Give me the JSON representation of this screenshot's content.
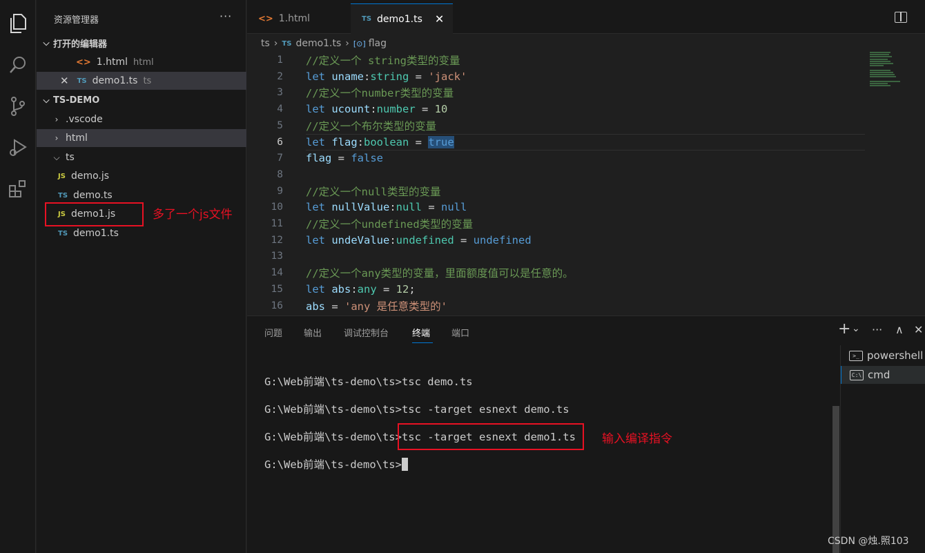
{
  "activity_bar": {
    "icons": [
      "explorer-icon",
      "search-icon",
      "source-control-icon",
      "run-debug-icon",
      "extensions-icon"
    ]
  },
  "sidebar": {
    "title": "资源管理器",
    "more": "···",
    "open_editors_label": "打开的编辑器",
    "open_editors": [
      {
        "name": "1.html",
        "hint": "html",
        "ext": "<>"
      },
      {
        "name": "demo1.ts",
        "hint": "ts",
        "ext": "TS"
      }
    ],
    "project_label": "TS-DEMO",
    "tree": [
      {
        "name": ".vscode",
        "kind": "folder"
      },
      {
        "name": "html",
        "kind": "folder"
      },
      {
        "name": "ts",
        "kind": "folder-open"
      },
      {
        "name": "demo.js",
        "ext": "JS"
      },
      {
        "name": "demo.ts",
        "ext": "TS"
      },
      {
        "name": "demo1.js",
        "ext": "JS"
      },
      {
        "name": "demo1.ts",
        "ext": "TS"
      }
    ],
    "annotation": "多了一个js文件"
  },
  "tabs": [
    {
      "label": "1.html",
      "ext": "<>"
    },
    {
      "label": "demo1.ts",
      "ext": "TS",
      "close": "✕"
    }
  ],
  "breadcrumb": {
    "folder": "ts",
    "file_ext": "TS",
    "file": "demo1.ts",
    "symbol_icon": "[⊙]",
    "symbol": "flag"
  },
  "code_lines": [
    {
      "n": "1",
      "tokens": [
        [
          "c-com",
          "//定义一个 string类型的变量"
        ]
      ]
    },
    {
      "n": "2",
      "tokens": [
        [
          "c-kw",
          "let "
        ],
        [
          "c-var",
          "uname"
        ],
        [
          "c-op",
          ":"
        ],
        [
          "c-type",
          "string"
        ],
        [
          "c-op",
          " = "
        ],
        [
          "c-str",
          "'jack'"
        ]
      ]
    },
    {
      "n": "3",
      "tokens": [
        [
          "c-com",
          "//定义一个number类型的变量"
        ]
      ]
    },
    {
      "n": "4",
      "tokens": [
        [
          "c-kw",
          "let "
        ],
        [
          "c-var",
          "ucount"
        ],
        [
          "c-op",
          ":"
        ],
        [
          "c-type",
          "number"
        ],
        [
          "c-op",
          " = "
        ],
        [
          "c-num",
          "10"
        ]
      ]
    },
    {
      "n": "5",
      "tokens": [
        [
          "c-com",
          "//定义一个布尔类型的变量"
        ]
      ]
    },
    {
      "n": "6",
      "tokens": [
        [
          "c-kw",
          "let "
        ],
        [
          "c-var",
          "flag"
        ],
        [
          "c-op",
          ":"
        ],
        [
          "c-type",
          "boolean"
        ],
        [
          "c-op",
          " = "
        ],
        [
          "c-kw c-sel",
          "true"
        ]
      ]
    },
    {
      "n": "7",
      "tokens": [
        [
          "c-var",
          "flag"
        ],
        [
          "c-op",
          " = "
        ],
        [
          "c-kw",
          "false"
        ]
      ]
    },
    {
      "n": "8",
      "tokens": []
    },
    {
      "n": "9",
      "tokens": [
        [
          "c-com",
          "//定义一个null类型的变量"
        ]
      ]
    },
    {
      "n": "10",
      "tokens": [
        [
          "c-kw",
          "let "
        ],
        [
          "c-var",
          "nullValue"
        ],
        [
          "c-op",
          ":"
        ],
        [
          "c-type",
          "null"
        ],
        [
          "c-op",
          " = "
        ],
        [
          "c-kw",
          "null"
        ]
      ]
    },
    {
      "n": "11",
      "tokens": [
        [
          "c-com",
          "//定义一个undefined类型的变量"
        ]
      ]
    },
    {
      "n": "12",
      "tokens": [
        [
          "c-kw",
          "let "
        ],
        [
          "c-var",
          "undeValue"
        ],
        [
          "c-op",
          ":"
        ],
        [
          "c-type",
          "undefined"
        ],
        [
          "c-op",
          " = "
        ],
        [
          "c-kw",
          "undefined"
        ]
      ]
    },
    {
      "n": "13",
      "tokens": []
    },
    {
      "n": "14",
      "tokens": [
        [
          "c-com",
          "//定义一个any类型的变量，里面额度值可以是任意的。"
        ]
      ]
    },
    {
      "n": "15",
      "tokens": [
        [
          "c-kw",
          "let "
        ],
        [
          "c-var",
          "abs"
        ],
        [
          "c-op",
          ":"
        ],
        [
          "c-type",
          "any"
        ],
        [
          "c-op",
          " = "
        ],
        [
          "c-num",
          "12"
        ],
        [
          "c-op",
          ";"
        ]
      ]
    },
    {
      "n": "16",
      "tokens": [
        [
          "c-var",
          "abs"
        ],
        [
          "c-op",
          " = "
        ],
        [
          "c-str",
          "'any 是任意类型的'"
        ]
      ]
    }
  ],
  "panel": {
    "tabs": [
      "问题",
      "输出",
      "调试控制台",
      "终端",
      "端口"
    ],
    "active_tab": "终端",
    "actions": {
      "add": "+",
      "dropdown": "⌄",
      "more": "···",
      "maximize": "∧",
      "close": "✕"
    },
    "terminal_lines": [
      "G:\\Web前端\\ts-demo\\ts>tsc demo.ts",
      "G:\\Web前端\\ts-demo\\ts>tsc -target esnext demo.ts",
      "G:\\Web前端\\ts-demo\\ts>tsc -target esnext demo1.ts",
      "G:\\Web前端\\ts-demo\\ts>"
    ],
    "terminals": [
      {
        "label": "powershell",
        "icon": ">_"
      },
      {
        "label": "cmd",
        "icon": "C:\\"
      }
    ],
    "annotation": "输入编译指令"
  },
  "watermark": "CSDN @烛.照103"
}
